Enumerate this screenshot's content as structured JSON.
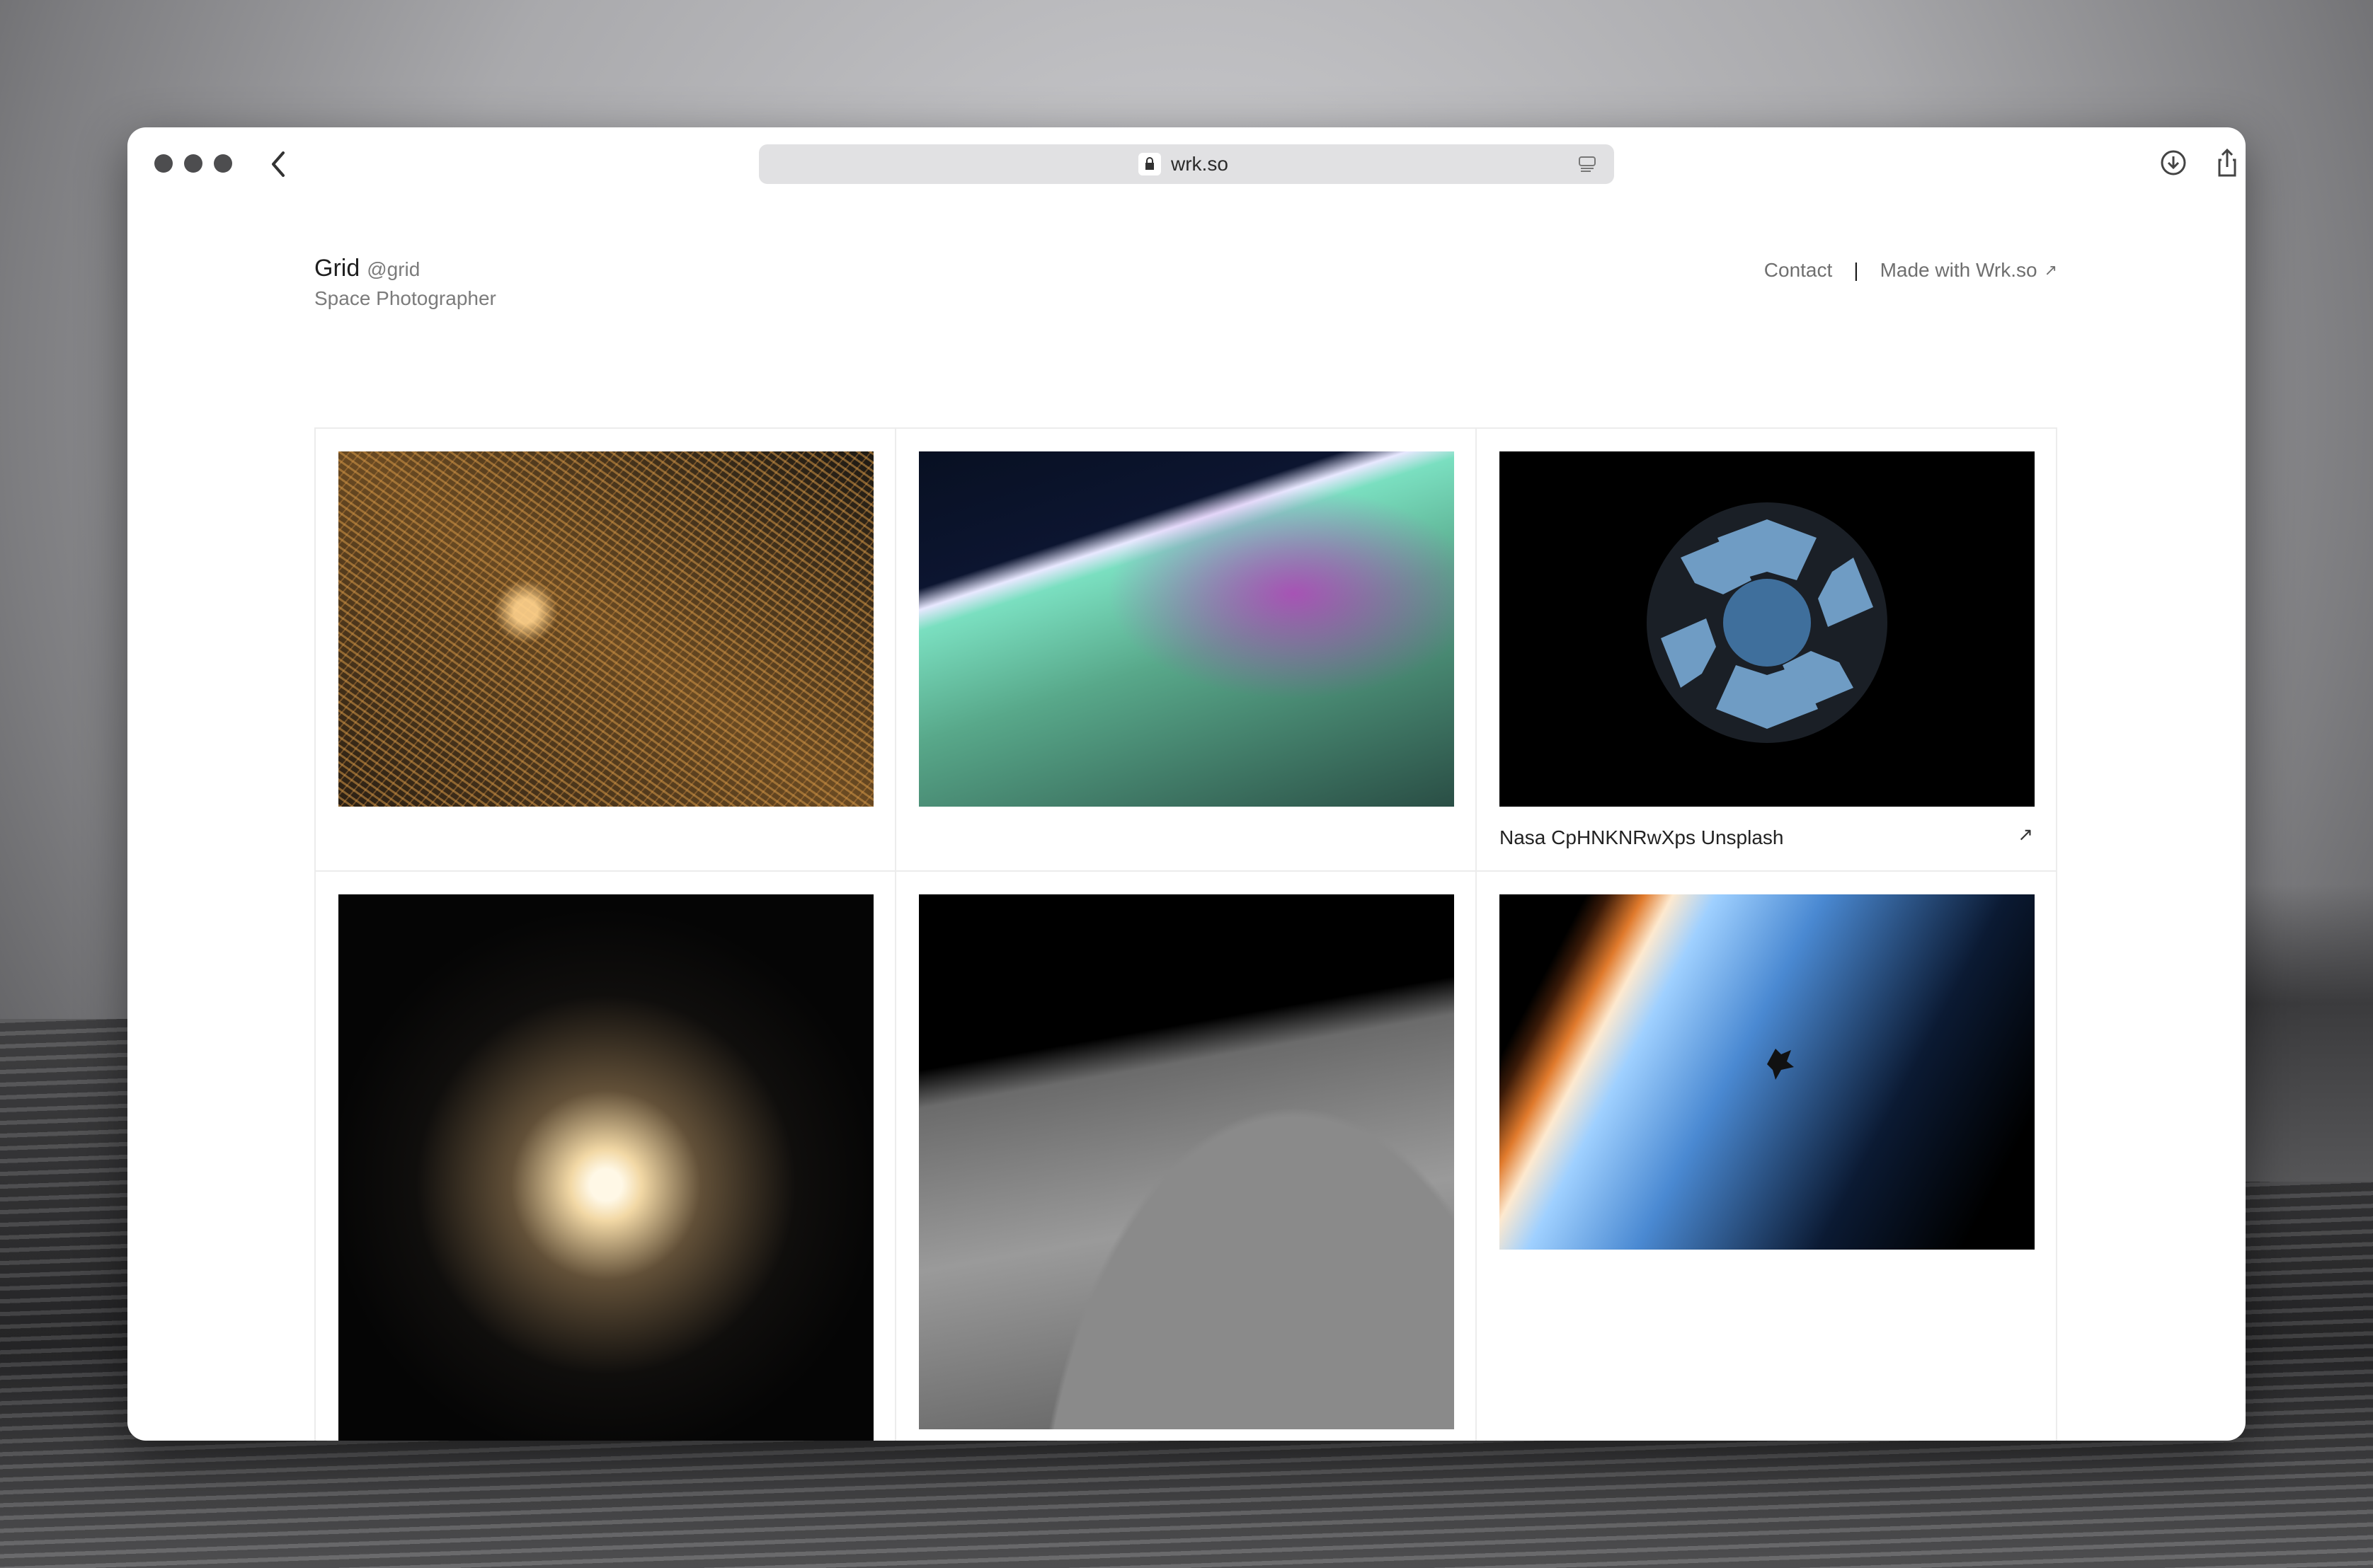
{
  "browser": {
    "url": "wrk.so"
  },
  "profile": {
    "name": "Grid",
    "handle": "@grid",
    "role": "Space Photographer"
  },
  "nav": {
    "contact": "Contact",
    "separator": "|",
    "made_with": "Made with Wrk.so",
    "arrow": "↗"
  },
  "gallery": {
    "items": [
      {
        "caption": "",
        "description": "night city lights from orbit"
      },
      {
        "caption": "",
        "description": "aurora and station arm over earth"
      },
      {
        "caption": "Nasa CpHNKNRwXps Unsplash",
        "external": "↗"
      },
      {
        "caption": "",
        "description": "star cluster"
      },
      {
        "caption": "",
        "description": "lunar surface"
      },
      {
        "caption": "",
        "description": "shuttle over earth horizon"
      }
    ]
  },
  "icons": [
    "chevron-left-icon",
    "lock-icon",
    "reader-icon",
    "download-icon",
    "share-icon",
    "plus-icon",
    "tabs-icon"
  ]
}
